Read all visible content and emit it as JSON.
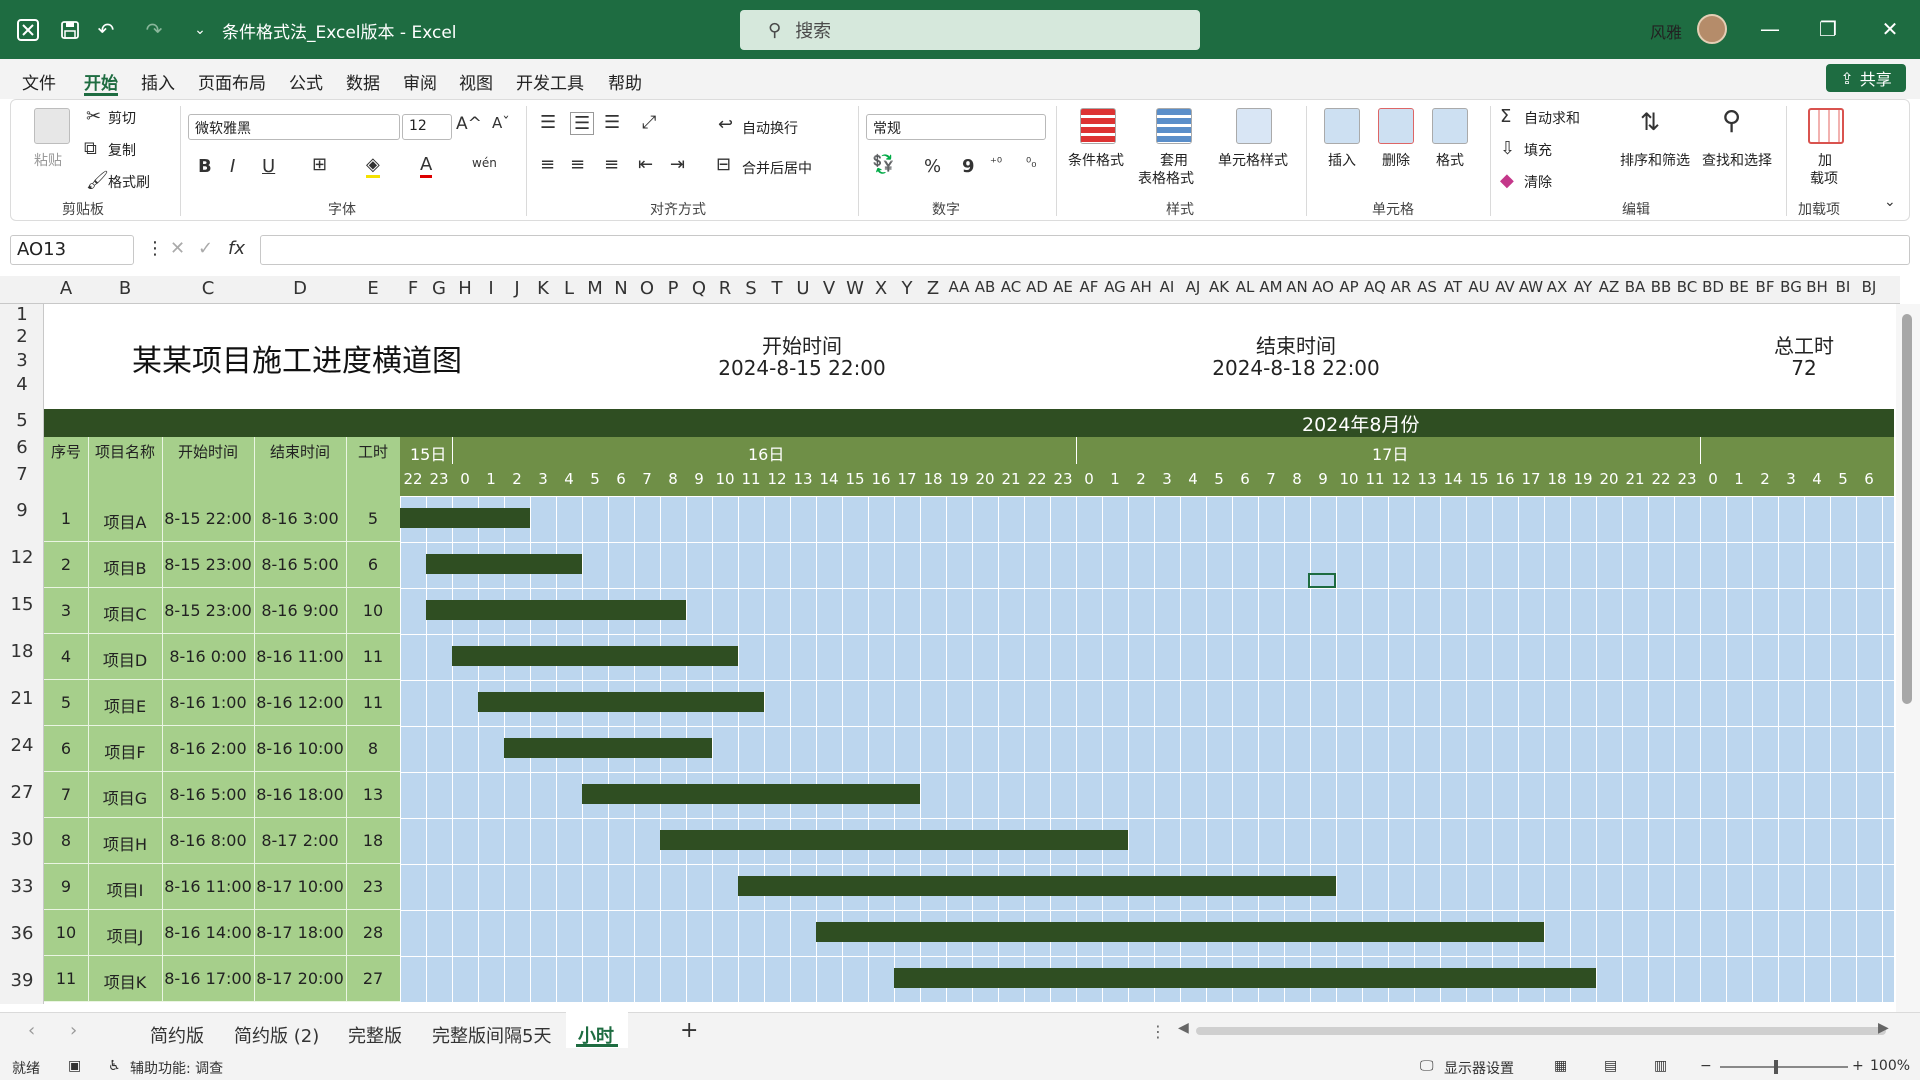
{
  "titlebar": {
    "doc_title": "条件格式法_Excel版本 - Excel",
    "search_placeholder": "搜索",
    "user_name": "风雅",
    "minimize": "—",
    "restore": "❐",
    "close": "✕"
  },
  "menu": {
    "tabs": [
      "文件",
      "开始",
      "插入",
      "页面布局",
      "公式",
      "数据",
      "审阅",
      "视图",
      "开发工具",
      "帮助"
    ],
    "active": "开始",
    "share": "共享"
  },
  "ribbon": {
    "clipboard": {
      "paste": "粘贴",
      "cut": "剪切",
      "copy": "复制",
      "format_painter": "格式刷",
      "label": "剪贴板"
    },
    "font": {
      "name": "微软雅黑",
      "size": "12",
      "bold": "B",
      "italic": "I",
      "underline": "U",
      "grow": "A^",
      "shrink": "Aˇ",
      "label": "字体"
    },
    "alignment": {
      "wrap": "自动换行",
      "merge": "合并后居中",
      "label": "对齐方式"
    },
    "number": {
      "format": "常规",
      "percent": "%",
      "comma": "9",
      "label": "数字"
    },
    "styles": {
      "conditional": "条件格式",
      "table_1": "套用",
      "table_2": "表格格式",
      "cell_styles": "单元格样式",
      "label": "样式"
    },
    "cells": {
      "insert": "插入",
      "delete": "删除",
      "format": "格式",
      "label": "单元格"
    },
    "editing": {
      "autosum": "自动求和",
      "fill": "填充",
      "clear": "清除",
      "sort": "排序和筛选",
      "find": "查找和选择",
      "label": "编辑"
    },
    "addins": {
      "add_1": "加",
      "add_2": "载项",
      "label": "加载项"
    }
  },
  "formula_bar": {
    "name_box": "AO13",
    "fx": "fx",
    "cancel": "✕",
    "enter": "✓"
  },
  "columns": [
    "A",
    "B",
    "C",
    "D",
    "E",
    "F",
    "G",
    "H",
    "I",
    "J",
    "K",
    "L",
    "M",
    "N",
    "O",
    "P",
    "Q",
    "R",
    "S",
    "T",
    "U",
    "V",
    "W",
    "X",
    "Y",
    "Z",
    "AA",
    "AB",
    "AC",
    "AD",
    "AE",
    "AF",
    "AG",
    "AH",
    "AI",
    "AJ",
    "AK",
    "AL",
    "AM",
    "AN",
    "AO",
    "AP",
    "AQ",
    "AR",
    "AS",
    "AT",
    "AU",
    "AV",
    "AW",
    "AX",
    "AY",
    "AZ",
    "BA",
    "BB",
    "BC",
    "BD",
    "BE",
    "BF",
    "BG",
    "BH",
    "BI",
    "BJ",
    "B"
  ],
  "rows": [
    "1",
    "2",
    "3",
    "4",
    "5",
    "6",
    "7",
    "9",
    "12",
    "15",
    "18",
    "21",
    "24",
    "27",
    "30",
    "33",
    "36",
    "39"
  ],
  "gantt": {
    "title": "某某项目施工进度横道图",
    "start_label": "开始时间",
    "start_value": "2024-8-15 22:00",
    "end_label": "结束时间",
    "end_value": "2024-8-18 22:00",
    "total_label": "总工时",
    "total_value": "72",
    "month": "2024年8月份",
    "days": [
      "15日",
      "16日",
      "17日"
    ],
    "hours": [
      "22",
      "23",
      "0",
      "1",
      "2",
      "3",
      "4",
      "5",
      "6",
      "7",
      "8",
      "9",
      "10",
      "11",
      "12",
      "13",
      "14",
      "15",
      "16",
      "17",
      "18",
      "19",
      "20",
      "21",
      "22",
      "23",
      "0",
      "1",
      "2",
      "3",
      "4",
      "5",
      "6",
      "7",
      "8",
      "9",
      "10",
      "11",
      "12",
      "13",
      "14",
      "15",
      "16",
      "17",
      "18",
      "19",
      "20",
      "21",
      "22",
      "23",
      "0",
      "1",
      "2",
      "3",
      "4",
      "5",
      "6"
    ],
    "col_headers": {
      "no": "序号",
      "name": "项目名称",
      "start": "开始时间",
      "end": "结束时间",
      "hours": "工时"
    },
    "tasks": [
      {
        "no": "1",
        "name": "项目A",
        "start": "8-15 22:00",
        "end": "8-16 3:00",
        "hours": "5",
        "offset": 0
      },
      {
        "no": "2",
        "name": "项目B",
        "start": "8-15 23:00",
        "end": "8-16 5:00",
        "hours": "6",
        "offset": 1
      },
      {
        "no": "3",
        "name": "项目C",
        "start": "8-15 23:00",
        "end": "8-16 9:00",
        "hours": "10",
        "offset": 1
      },
      {
        "no": "4",
        "name": "项目D",
        "start": "8-16 0:00",
        "end": "8-16 11:00",
        "hours": "11",
        "offset": 2
      },
      {
        "no": "5",
        "name": "项目E",
        "start": "8-16 1:00",
        "end": "8-16 12:00",
        "hours": "11",
        "offset": 3
      },
      {
        "no": "6",
        "name": "项目F",
        "start": "8-16 2:00",
        "end": "8-16 10:00",
        "hours": "8",
        "offset": 4
      },
      {
        "no": "7",
        "name": "项目G",
        "start": "8-16 5:00",
        "end": "8-16 18:00",
        "hours": "13",
        "offset": 7
      },
      {
        "no": "8",
        "name": "项目H",
        "start": "8-16 8:00",
        "end": "8-17 2:00",
        "hours": "18",
        "offset": 10
      },
      {
        "no": "9",
        "name": "项目I",
        "start": "8-16 11:00",
        "end": "8-17 10:00",
        "hours": "23",
        "offset": 13
      },
      {
        "no": "10",
        "name": "项目J",
        "start": "8-16 14:00",
        "end": "8-17 18:00",
        "hours": "28",
        "offset": 16
      },
      {
        "no": "11",
        "name": "项目K",
        "start": "8-16 17:00",
        "end": "8-17 20:00",
        "hours": "27",
        "offset": 19
      }
    ]
  },
  "sheet_tabs": {
    "tabs": [
      "简约版",
      "简约版 (2)",
      "完整版",
      "完整版间隔5天",
      "小时"
    ],
    "active": "小时",
    "add": "+"
  },
  "status": {
    "ready": "就绪",
    "accessibility": "辅助功能: 调查",
    "display": "显示器设置",
    "zoom": "100%"
  }
}
